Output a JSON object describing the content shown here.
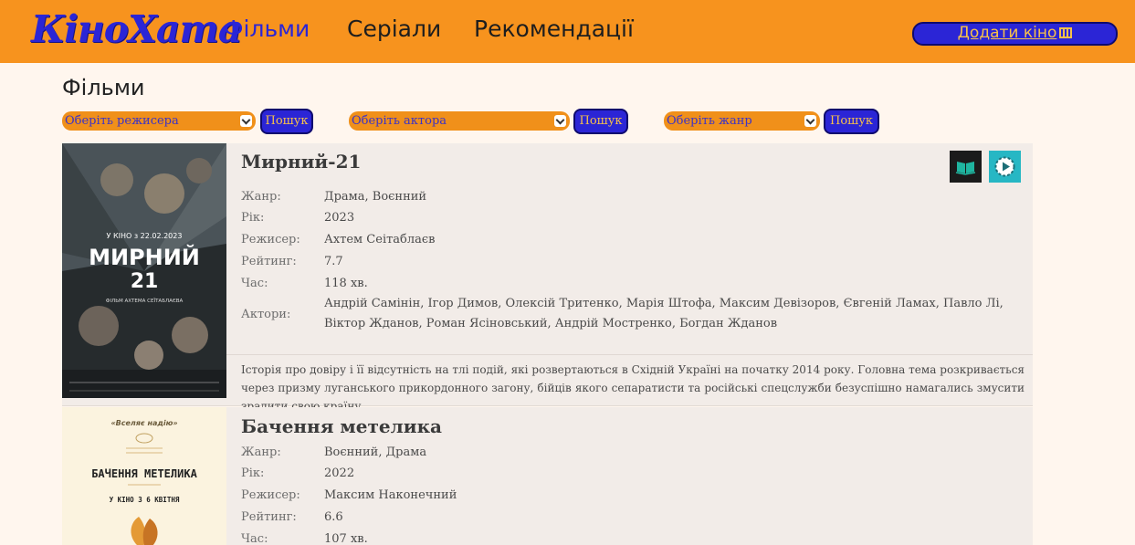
{
  "header": {
    "logo": "КіноХата",
    "nav": [
      "Фільми",
      "Серіали",
      "Рекомендації"
    ],
    "add_button": "Додати кіно"
  },
  "page": {
    "title": "Фільми"
  },
  "filters": [
    {
      "placeholder": "Оберіть режисера",
      "button": "Пошук"
    },
    {
      "placeholder": "Оберіть актора",
      "button": "Пошук"
    },
    {
      "placeholder": "Оберіть жанр",
      "button": "Пошук"
    }
  ],
  "labels": {
    "genre": "Жанр:",
    "year": "Рік:",
    "director": "Режисер:",
    "rating": "Рейтинг:",
    "time": "Час:",
    "actors": "Актори:"
  },
  "films": [
    {
      "title": "Мирний-21",
      "genre": "Драма, Воєнний",
      "year": "2023",
      "director": "Ахтем Сеітаблаєв",
      "rating": "7.7",
      "time": "118 хв.",
      "actors": "Андрій Самінін, Ігор Димов, Олексій Тритенко, Марія Штофа, Максим Девізоров, Євгеній Ламах, Павло Лі, Віктор Жданов, Роман Ясіновський, Андрій Мостренко, Богдан Жданов",
      "description": "Історія про довіру і її відсутність на тлі подій, які розвертаються в Східній Україні на початку 2014 року. Головна тема розкривається через призму луганського прикордонного загону, бійців якого сепаратисти та російські спецслужби безуспішно намагались змусити зрадити свою країну.",
      "poster": {
        "top_text": "У КІНО з 22.02.2023",
        "title_line1": "МИРНИЙ",
        "title_line2": "21",
        "subtitle": "ФІЛЬМ АХТЕМА СЕЇТАБЛАЄВА"
      },
      "icons": [
        "book-icon",
        "play-icon"
      ],
      "colors": {
        "book_icon_bg": "#1b1b1b",
        "book_icon_fg": "#1fb5a0",
        "play_icon_bg": "#27b7c4"
      }
    },
    {
      "title": "Бачення метелика",
      "genre": "Воєнний, Драма",
      "year": "2022",
      "director": "Максим Наконечний",
      "rating": "6.6",
      "time": "107 хв.",
      "poster": {
        "tagline": "«Вселяє надію»",
        "title": "БАЧЕННЯ МЕТЕЛИКА",
        "release": "У КІНО З 6 КВІТНЯ"
      }
    }
  ],
  "colors": {
    "header": "#f7931e",
    "accent_blue": "#2b25d6",
    "button_text": "#f7c14a",
    "page_bg": "#fff6ee",
    "card_bg": "#f2ece8"
  }
}
